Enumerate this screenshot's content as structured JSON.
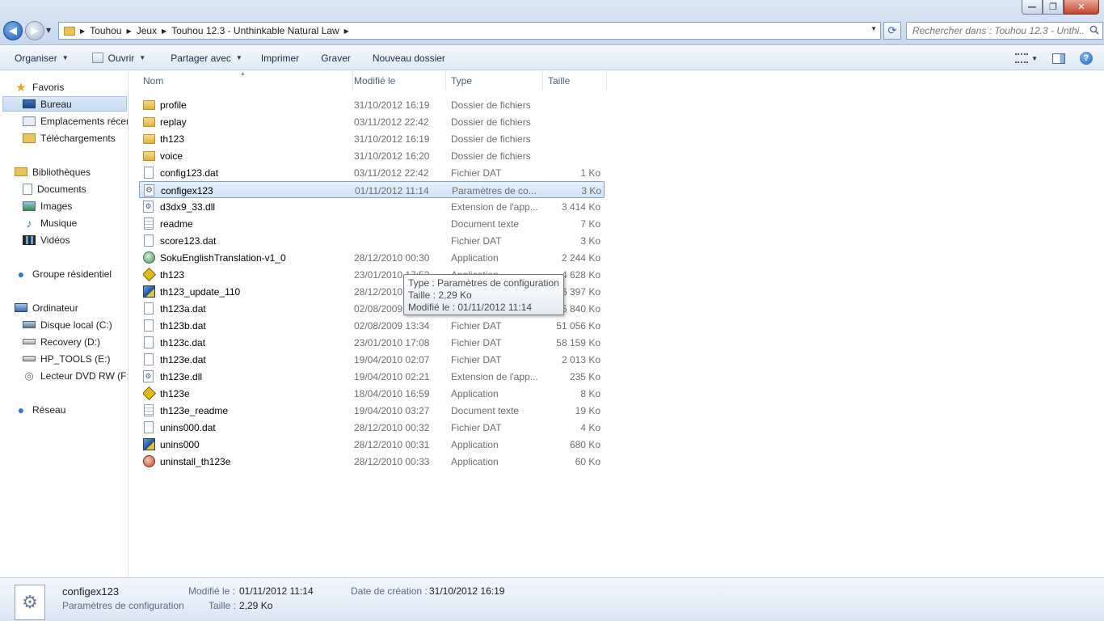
{
  "window": {
    "minimize": "—",
    "maximize": "❐",
    "close": "✕"
  },
  "address": {
    "crumbs": [
      "Touhou",
      "Jeux",
      "Touhou 12.3 - Unthinkable Natural Law"
    ],
    "search_placeholder": "Rechercher dans : Touhou 12.3 - Unthi..."
  },
  "toolbar": {
    "organiser": "Organiser",
    "ouvrir": "Ouvrir",
    "partager": "Partager avec",
    "imprimer": "Imprimer",
    "graver": "Graver",
    "nouveau_dossier": "Nouveau dossier"
  },
  "sidebar": {
    "favoris": "Favoris",
    "bureau": "Bureau",
    "emplacements": "Emplacements récents",
    "telechargements": "Téléchargements",
    "bibliotheques": "Bibliothèques",
    "documents": "Documents",
    "images": "Images",
    "musique": "Musique",
    "videos": "Vidéos",
    "groupe": "Groupe résidentiel",
    "ordinateur": "Ordinateur",
    "disque_c": "Disque local (C:)",
    "recovery_d": "Recovery (D:)",
    "hp_tools_e": "HP_TOOLS (E:)",
    "dvd_f": "Lecteur DVD RW (F:)",
    "reseau": "Réseau"
  },
  "columns": {
    "nom": "Nom",
    "modifie": "Modifié le",
    "type": "Type",
    "taille": "Taille"
  },
  "files": [
    {
      "name": "profile",
      "date": "31/10/2012 16:19",
      "type": "Dossier de fichiers",
      "size": "",
      "icon": "folder"
    },
    {
      "name": "replay",
      "date": "03/11/2012 22:42",
      "type": "Dossier de fichiers",
      "size": "",
      "icon": "folder"
    },
    {
      "name": "th123",
      "date": "31/10/2012 16:19",
      "type": "Dossier de fichiers",
      "size": "",
      "icon": "folder"
    },
    {
      "name": "voice",
      "date": "31/10/2012 16:20",
      "type": "Dossier de fichiers",
      "size": "",
      "icon": "folder"
    },
    {
      "name": "config123.dat",
      "date": "03/11/2012 22:42",
      "type": "Fichier DAT",
      "size": "1 Ko",
      "icon": "file"
    },
    {
      "name": "configex123",
      "date": "01/11/2012 11:14",
      "type": "Paramètres de co...",
      "size": "3 Ko",
      "icon": "cfg"
    },
    {
      "name": "d3dx9_33.dll",
      "date": "",
      "type": "Extension de l'app...",
      "size": "3 414 Ko",
      "icon": "dll"
    },
    {
      "name": "readme",
      "date": "",
      "type": "Document texte",
      "size": "7 Ko",
      "icon": "txt"
    },
    {
      "name": "score123.dat",
      "date": "",
      "type": "Fichier DAT",
      "size": "3 Ko",
      "icon": "file"
    },
    {
      "name": "SokuEnglishTranslation-v1_0",
      "date": "28/12/2010 00:30",
      "type": "Application",
      "size": "2 244 Ko",
      "icon": "app-soku"
    },
    {
      "name": "th123",
      "date": "23/01/2010 17:53",
      "type": "Application",
      "size": "4 628 Ko",
      "icon": "app-th"
    },
    {
      "name": "th123_update_110",
      "date": "28/12/2010 00:30",
      "type": "Application",
      "size": "6 397 Ko",
      "icon": "app-setup"
    },
    {
      "name": "th123a.dat",
      "date": "02/08/2009 13:33",
      "type": "Fichier DAT",
      "size": "985 840 Ko",
      "icon": "file"
    },
    {
      "name": "th123b.dat",
      "date": "02/08/2009 13:34",
      "type": "Fichier DAT",
      "size": "51 056 Ko",
      "icon": "file"
    },
    {
      "name": "th123c.dat",
      "date": "23/01/2010 17:08",
      "type": "Fichier DAT",
      "size": "58 159 Ko",
      "icon": "file"
    },
    {
      "name": "th123e.dat",
      "date": "19/04/2010 02:07",
      "type": "Fichier DAT",
      "size": "2 013 Ko",
      "icon": "file"
    },
    {
      "name": "th123e.dll",
      "date": "19/04/2010 02:21",
      "type": "Extension de l'app...",
      "size": "235 Ko",
      "icon": "dll"
    },
    {
      "name": "th123e",
      "date": "18/04/2010 16:59",
      "type": "Application",
      "size": "8 Ko",
      "icon": "app-th"
    },
    {
      "name": "th123e_readme",
      "date": "19/04/2010 03:27",
      "type": "Document texte",
      "size": "19 Ko",
      "icon": "txt"
    },
    {
      "name": "unins000.dat",
      "date": "28/12/2010 00:32",
      "type": "Fichier DAT",
      "size": "4 Ko",
      "icon": "file"
    },
    {
      "name": "unins000",
      "date": "28/12/2010 00:31",
      "type": "Application",
      "size": "680 Ko",
      "icon": "app-setup"
    },
    {
      "name": "uninstall_th123e",
      "date": "28/12/2010 00:33",
      "type": "Application",
      "size": "60 Ko",
      "icon": "app-uninst"
    }
  ],
  "selected_index": 5,
  "tooltip": {
    "line1": "Type : Paramètres de configuration",
    "line2": "Taille : 2,29 Ko",
    "line3": "Modifié le : 01/11/2012 11:14"
  },
  "details": {
    "name": "configex123",
    "type": "Paramètres de configuration",
    "modified_label": "Modifié le :",
    "modified_value": "01/11/2012 11:14",
    "size_label": "Taille :",
    "size_value": "2,29 Ko",
    "created_label": "Date de création :",
    "created_value": "31/10/2012 16:19"
  }
}
